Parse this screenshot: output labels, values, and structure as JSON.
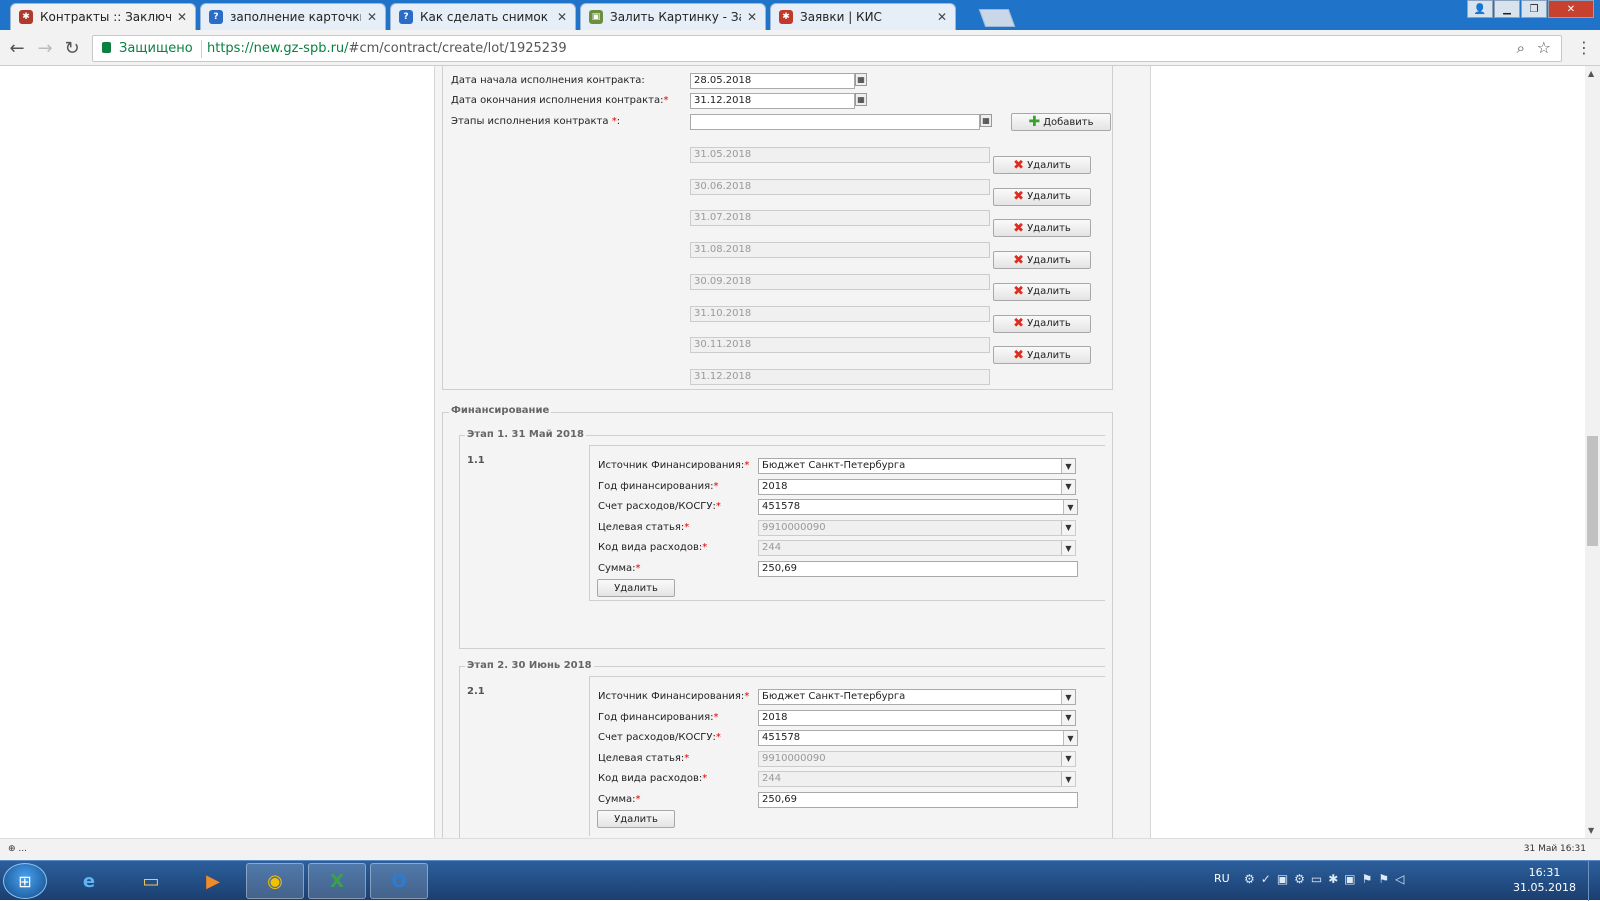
{
  "browser": {
    "tabs": [
      {
        "title": "Контракты :: Заключени",
        "active": true,
        "fav": "kis",
        "fav_color": "#b03a2e"
      },
      {
        "title": "заполнение карточки ко",
        "active": false,
        "fav": "q",
        "fav_color": "#2b6cc4"
      },
      {
        "title": "Как сделать снимок экра",
        "active": false,
        "fav": "q",
        "fav_color": "#2b6cc4"
      },
      {
        "title": "Залить Картинку - Загру",
        "active": false,
        "fav": "img",
        "fav_color": "#6b8f3c"
      },
      {
        "title": "Заявки | КИС",
        "active": false,
        "fav": "kis",
        "fav_color": "#c0392b"
      }
    ],
    "secure_label": "Защищено",
    "url_host": "https://new.gz-spb.ru/",
    "url_path": "#cm/contract/create/lot/1925239"
  },
  "form": {
    "start_date_label": "Дата начала исполнения контракта:",
    "start_date": "28.05.2018",
    "end_date_label": "Дата окончания исполнения контракта:",
    "end_date": "31.12.2018",
    "stages_label": "Этапы исполнения контракта ",
    "stages_input": "",
    "add_button": "Добавить",
    "delete_button": "Удалить",
    "stage_dates": [
      "31.05.2018",
      "30.06.2018",
      "31.07.2018",
      "31.08.2018",
      "30.09.2018",
      "31.10.2018",
      "30.11.2018",
      "31.12.2018"
    ]
  },
  "financing": {
    "legend": "Финансирование",
    "labels": {
      "source": "Источник Финансирования:",
      "year": "Год финансирования:",
      "account": "Счет расходов/КОСГУ:",
      "target": "Целевая статья:",
      "code": "Код вида расходов:",
      "sum": "Сумма:"
    },
    "delete_button": "Удалить",
    "stages": [
      {
        "legend": "Этап 1. 31 Май 2018",
        "number": "1.1",
        "source": "Бюджет Санкт-Петербурга",
        "year": "2018",
        "account": "451578",
        "target": "9910000090",
        "code": "244",
        "sum": "250,69"
      },
      {
        "legend": "Этап 2. 30 Июнь 2018",
        "number": "2.1",
        "source": "Бюджет Санкт-Петербурга",
        "year": "2018",
        "account": "451578",
        "target": "9910000090",
        "code": "244",
        "sum": "250,69"
      }
    ]
  },
  "status": {
    "left": "⊕ ...",
    "right": "31 Май 16:31"
  },
  "taskbar": {
    "apps": [
      "ie-icon",
      "explorer-icon",
      "media-player-icon",
      "chrome-icon",
      "excel-icon",
      "outlook-icon"
    ],
    "lang": "RU",
    "time": "16:31",
    "date": "31.05.2018"
  }
}
